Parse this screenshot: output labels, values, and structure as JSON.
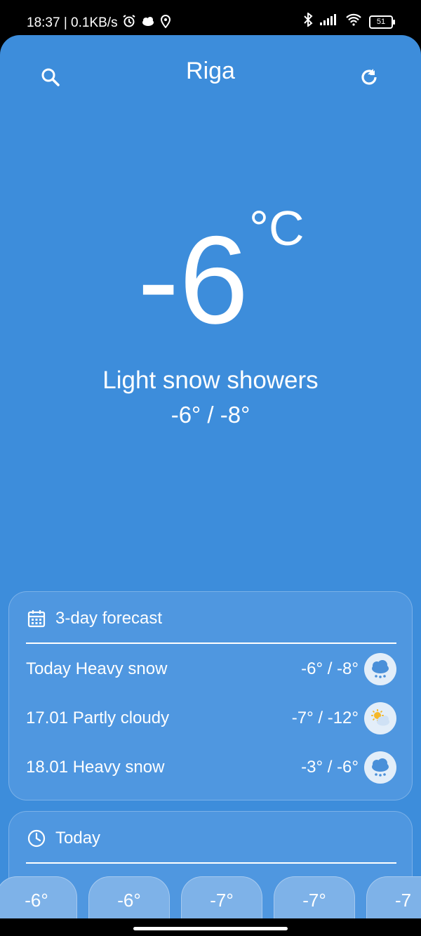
{
  "status_bar": {
    "time_speed": "18:37 | 0.1KB/s",
    "battery": "51"
  },
  "header": {
    "city": "Riga"
  },
  "current": {
    "temperature": "-6",
    "unit": "°C",
    "condition": "Light snow showers",
    "range": "-6° / -8°"
  },
  "forecast": {
    "title": "3-day forecast",
    "days": [
      {
        "label": "Today Heavy snow",
        "temps": "-6° / -8°",
        "icon": "heavy-snow-icon"
      },
      {
        "label": "17.01 Partly cloudy",
        "temps": "-7° / -12°",
        "icon": "partly-cloudy-icon"
      },
      {
        "label": "18.01 Heavy snow",
        "temps": "-3° / -6°",
        "icon": "heavy-snow-icon"
      }
    ]
  },
  "today": {
    "title": "Today",
    "hours": [
      {
        "temp": "-6°"
      },
      {
        "temp": "-6°"
      },
      {
        "temp": "-7°"
      },
      {
        "temp": "-7°"
      },
      {
        "temp": "-7"
      }
    ]
  },
  "colors": {
    "background": "#3d8ddb",
    "card": "#4f97e0",
    "text": "#ffffff"
  }
}
